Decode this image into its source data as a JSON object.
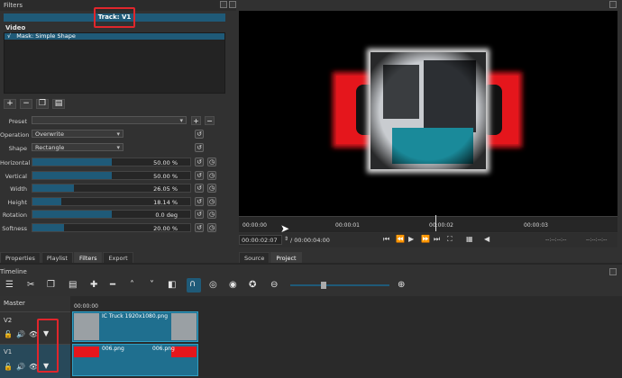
{
  "filters_panel": {
    "title": "Filters",
    "track_label": "Track: V1",
    "section_label": "Video",
    "filter_items": [
      {
        "checked": "√",
        "label": "Mask: Simple Shape"
      }
    ],
    "buttons": {
      "add": "+",
      "remove": "−"
    },
    "preset_label": "Preset",
    "operation": {
      "label": "Operation",
      "value": "Overwrite"
    },
    "shape": {
      "label": "Shape",
      "value": "Rectangle"
    },
    "params": [
      {
        "label": "Horizontal",
        "value": "50.00 %",
        "fill": 0.5
      },
      {
        "label": "Vertical",
        "value": "50.00 %",
        "fill": 0.5
      },
      {
        "label": "Width",
        "value": "26.05 %",
        "fill": 0.26
      },
      {
        "label": "Height",
        "value": "18.14 %",
        "fill": 0.18
      },
      {
        "label": "Rotation",
        "value": "0.0 deg",
        "fill": 0.5
      },
      {
        "label": "Softness",
        "value": "20.00 %",
        "fill": 0.2
      }
    ],
    "tabs": [
      "Properties",
      "Playlist",
      "Filters",
      "Export"
    ]
  },
  "viewer": {
    "ruler_ticks": [
      "00:00:00",
      "00:00:01",
      "00:00:02",
      "00:00:03"
    ],
    "current_time": "00:00:02:07",
    "duration": "/ 00:00:04:00",
    "in_point": "--:--:--:--",
    "out_point": "--:--:--:--",
    "tabs": [
      "Source",
      "Project"
    ]
  },
  "timeline": {
    "title": "Timeline",
    "master_label": "Master",
    "tracks": [
      {
        "name": "V2",
        "clip_label": "IC Truck 1920x1080.png"
      },
      {
        "name": "V1",
        "clip_label_a": "006.png",
        "clip_label_b": "006.png"
      }
    ],
    "clip_time": "00:00:00"
  },
  "colors": {
    "accent": "#1f5a78",
    "highlight": "#e0262c",
    "clip": "#1f6f8f"
  }
}
